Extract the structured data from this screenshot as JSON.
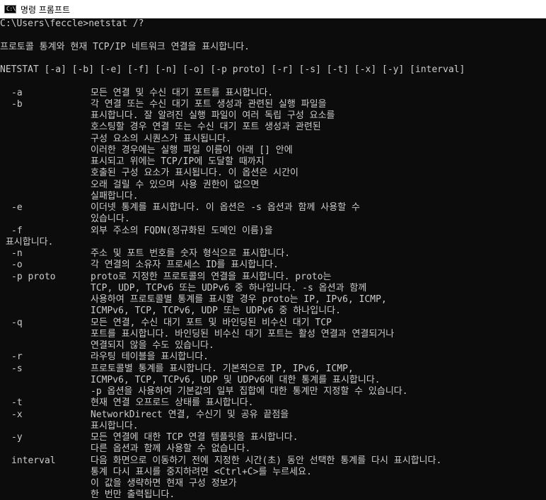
{
  "window": {
    "title": "명령 프롬프트",
    "icon": "cmd-icon",
    "icon_glyph": "C:\\"
  },
  "console": {
    "lines": [
      {
        "full": "C:\\Users\\feccle>netstat /?"
      },
      {
        "full": ""
      },
      {
        "full": "프로토콜 통계와 현재 TCP/IP 네트워크 연결을 표시합니다."
      },
      {
        "full": ""
      },
      {
        "full": "NETSTAT [-a] [-b] [-e] [-f] [-n] [-o] [-p proto] [-r] [-s] [-t] [-x] [-y] [interval]"
      },
      {
        "full": ""
      },
      {
        "opt": "-a",
        "desc": "모든 연결 및 수신 대기 포트를 표시합니다."
      },
      {
        "opt": "-b",
        "desc": "각 연결 또는 수신 대기 포트 생성과 관련된 실행 파일을"
      },
      {
        "desc": "표시합니다. 잘 알려진 실행 파일이 여러 독립 구성 요소를"
      },
      {
        "desc": "호스팅할 경우 연결 또는 수신 대기 포트 생성과 관련된"
      },
      {
        "desc": "구성 요소의 시퀀스가 표시됩니다."
      },
      {
        "desc": "이러한 경우에는 실행 파일 이름이 아래 [] 안에"
      },
      {
        "desc": "표시되고 위에는 TCP/IP에 도달할 때까지"
      },
      {
        "desc": "호출된 구성 요소가 표시됩니다. 이 옵션은 시간이"
      },
      {
        "desc": "오래 걸릴 수 있으며 사용 권한이 없으면"
      },
      {
        "desc": "실패합니다."
      },
      {
        "opt": "-e",
        "desc": "이더넷 통계를 표시합니다. 이 옵션은 -s 옵션과 함께 사용할 수"
      },
      {
        "desc": "있습니다."
      },
      {
        "opt": "-f",
        "desc": "외부 주소의 FQDN(정규화된 도메인 이름)을"
      },
      {
        "full": " 표시합니다."
      },
      {
        "opt": "-n",
        "desc": "주소 및 포트 번호를 숫자 형식으로 표시합니다."
      },
      {
        "opt": "-o",
        "desc": "각 연결의 소유자 프로세스 ID를 표시합니다."
      },
      {
        "opt": "-p proto",
        "desc": "proto로 지정한 프로토콜의 연결을 표시합니다. proto는"
      },
      {
        "desc": "TCP, UDP, TCPv6 또는 UDPv6 중 하나입니다. -s 옵션과 함께"
      },
      {
        "desc": "사용하여 프로토콜별 통계를 표시할 경우 proto는 IP, IPv6, ICMP,"
      },
      {
        "desc": "ICMPv6, TCP, TCPv6, UDP 또는 UDPv6 중 하나입니다."
      },
      {
        "opt": "-q",
        "desc": "모든 연결, 수신 대기 포트 및 바인딩된 비수신 대기 TCP"
      },
      {
        "desc": "포트를 표시합니다. 바인딩된 비수신 대기 포트는 활성 연결과 연결되거나"
      },
      {
        "desc": "연결되지 않을 수도 있습니다."
      },
      {
        "opt": "-r",
        "desc": "라우팅 테이블을 표시합니다."
      },
      {
        "opt": "-s",
        "desc": "프로토콜별 통계를 표시합니다. 기본적으로 IP, IPv6, ICMP,"
      },
      {
        "desc": "ICMPv6, TCP, TCPv6, UDP 및 UDPv6에 대한 통계를 표시합니다."
      },
      {
        "desc": "-p 옵션을 사용하여 기본값의 일부 집합에 대한 통계만 지정할 수 있습니다."
      },
      {
        "opt": "-t",
        "desc": "현재 연결 오프로드 상태를 표시합니다."
      },
      {
        "opt": "-x",
        "desc": "NetworkDirect 연결, 수신기 및 공유 끝점을"
      },
      {
        "desc": "표시합니다."
      },
      {
        "opt": "-y",
        "desc": "모든 연결에 대한 TCP 연결 템플릿을 표시합니다."
      },
      {
        "desc": "다른 옵션과 함께 사용할 수 없습니다."
      },
      {
        "opt": "interval",
        "desc": "다음 화면으로 이동하기 전에 지정한 시간(초) 동안 선택한 통계를 다시 표시합니다."
      },
      {
        "desc": "통계 다시 표시를 중지하려면 <Ctrl+C>를 누르세요."
      },
      {
        "desc": "이 값을 생략하면 현재 구성 정보가"
      },
      {
        "desc": "한 번만 출력됩니다."
      }
    ]
  },
  "colors": {
    "console_background": "#0c0c0c",
    "console_text": "#cccccc",
    "titlebar_background": "#ffffff"
  }
}
